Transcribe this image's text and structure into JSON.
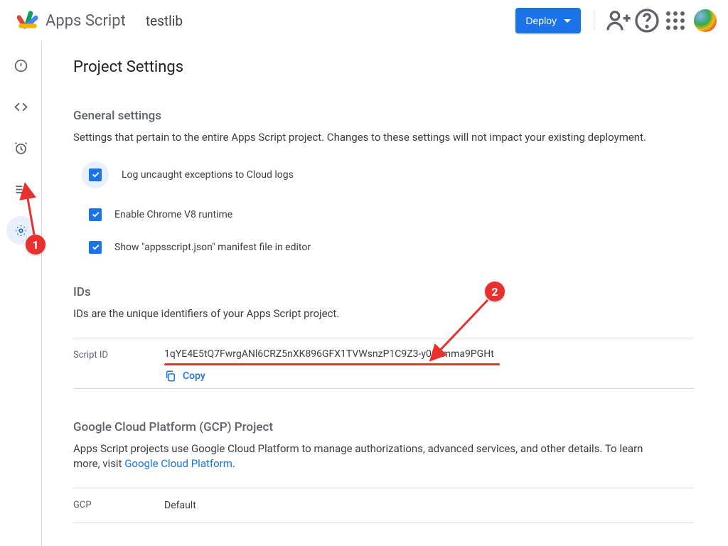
{
  "header": {
    "app_name": "Apps Script",
    "project_name": "testlib",
    "deploy_label": "Deploy"
  },
  "nav": {
    "overview": "overview-icon",
    "editor": "editor-icon",
    "triggers": "triggers-icon",
    "executions": "executions-icon",
    "settings": "settings-icon"
  },
  "page_title": "Project Settings",
  "general": {
    "title": "General settings",
    "desc": "Settings that pertain to the entire Apps Script project. Changes to these settings will not impact your existing deployment.",
    "opts": [
      "Log uncaught exceptions to Cloud logs",
      "Enable Chrome V8 runtime",
      "Show \"appsscript.json\" manifest file in editor"
    ]
  },
  "ids": {
    "title": "IDs",
    "desc": "IDs are the unique identifiers of your Apps Script project.",
    "script_id_label": "Script ID",
    "script_id_value": "1qYE4E5tQ7FwrgANl6CRZ5nXK896GFX1TVWsnzP1C9Z3-y0qzmma9PGHt",
    "copy_label": "Copy"
  },
  "gcp": {
    "title": "Google Cloud Platform (GCP) Project",
    "desc_pre": "Apps Script projects use Google Cloud Platform to manage authorizations, advanced services, and other details. To learn more, visit ",
    "desc_link": "Google Cloud Platform",
    "desc_post": ".",
    "key": "GCP",
    "value": "Default"
  },
  "annotations": {
    "b1": "1",
    "b2": "2"
  }
}
